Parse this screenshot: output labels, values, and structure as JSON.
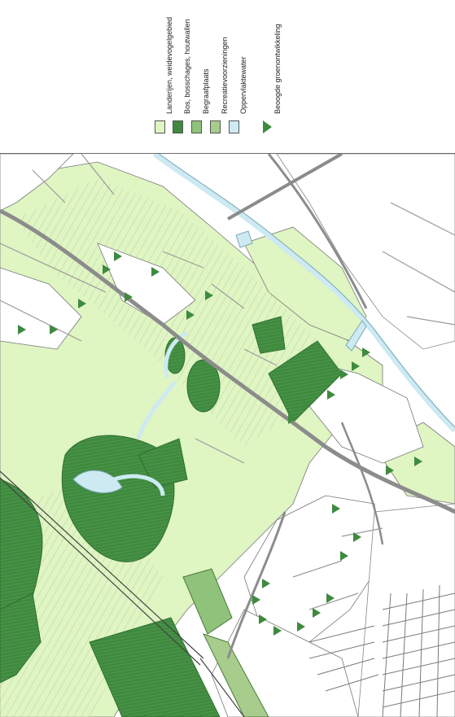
{
  "legend": {
    "items": [
      {
        "label": "Landerijen, weidevogelgebied",
        "color": "#dff5c2",
        "symbol": "square",
        "icon": "light-green-square-icon"
      },
      {
        "label": "Bos, bosschages, houtwallen",
        "color": "#3f8a3f",
        "symbol": "square",
        "icon": "dark-green-square-icon"
      },
      {
        "label": "Begraafplaats",
        "color": "#8fc27a",
        "symbol": "square",
        "icon": "medium-green-square-icon"
      },
      {
        "label": "Recreatievoorzieningen",
        "color": "#a7cc8c",
        "symbol": "square",
        "icon": "medium-green-square-icon"
      },
      {
        "label": "Oppervlaktewater",
        "color": "#cdeaf2",
        "symbol": "square",
        "icon": "light-blue-square-icon"
      },
      {
        "label": "Beoogde groenontwikkeling",
        "color": "#3f8a3f",
        "symbol": "triangle",
        "icon": "green-triangle-icon"
      }
    ]
  },
  "map": {
    "colors": {
      "meadow": "#dff5c2",
      "forest": "#3f8a3f",
      "water": "#cdeaf2",
      "road": "#8c8c8c",
      "built": "#ffffff",
      "outline": "#555555"
    }
  }
}
